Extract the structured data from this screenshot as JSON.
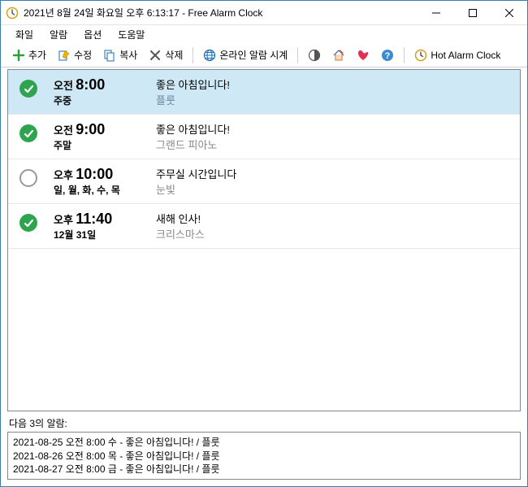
{
  "window": {
    "title": "2021년 8월 24일 화요일 오후 6:13:17 - Free Alarm Clock"
  },
  "menu": {
    "file": "화일",
    "alarm": "알람",
    "options": "옵션",
    "help": "도움말"
  },
  "toolbar": {
    "add": "추가",
    "edit": "수정",
    "copy": "복사",
    "delete": "삭제",
    "online": "온라인 알람 시계",
    "hot": "Hot Alarm Clock"
  },
  "alarms": [
    {
      "enabled": true,
      "ampm": "오전",
      "time": "8:00",
      "days": "주중",
      "title": "좋은 아침입니다!",
      "sound": "플룻",
      "selected": true
    },
    {
      "enabled": true,
      "ampm": "오전",
      "time": "9:00",
      "days": "주말",
      "title": "좋은 아침입니다!",
      "sound": "그랜드 피아노",
      "selected": false
    },
    {
      "enabled": false,
      "ampm": "오후",
      "time": "10:00",
      "days": "일, 월, 화, 수, 목",
      "title": "주무실 시간입니다",
      "sound": "눈빛",
      "selected": false
    },
    {
      "enabled": true,
      "ampm": "오후",
      "time": "11:40",
      "days": "12월 31일",
      "title": "새해 인사!",
      "sound": "크리스마스",
      "selected": false
    }
  ],
  "next": {
    "heading": "다음 3의 알람:",
    "lines": [
      "2021-08-25 오전 8:00 수 - 좋은 아침입니다! / 플룻",
      "2021-08-26 오전 8:00 목 - 좋은 아침입니다! / 플룻",
      "2021-08-27 오전 8:00 금 - 좋은 아침입니다! / 플룻"
    ]
  }
}
